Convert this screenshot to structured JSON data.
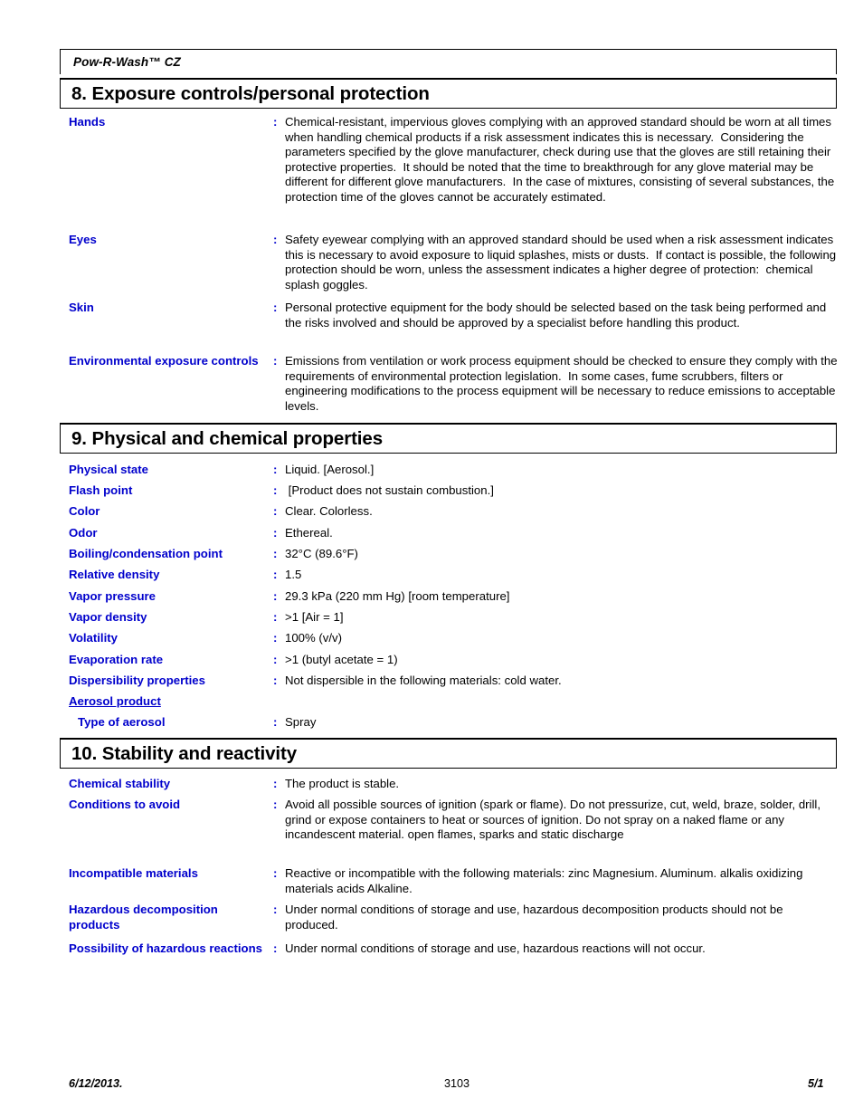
{
  "header": {
    "product_name": "Pow-R-Wash™ CZ"
  },
  "sections": [
    {
      "id": "section-8",
      "title": "8. Exposure controls/personal protection",
      "rows": [
        {
          "label": "Hands",
          "colon": ":",
          "value": "Chemical-resistant, impervious gloves complying with an approved standard should be worn at all times when handling chemical products if a risk assessment indicates this is necessary.  Considering the parameters specified by the glove manufacturer, check during use that the gloves are still retaining their protective properties.  It should be noted that the time to breakthrough for any glove material may be different for different glove manufacturers.  In the case of mixtures, consisting of several substances, the protection time of the gloves cannot be accurately estimated."
        },
        {
          "label": "Eyes",
          "colon": ":",
          "value": "Safety eyewear complying with an approved standard should be used when a risk assessment indicates this is necessary to avoid exposure to liquid splashes, mists or dusts.  If contact is possible, the following protection should be worn, unless the assessment indicates a higher degree of protection:  chemical splash goggles."
        },
        {
          "label": "Skin",
          "colon": ":",
          "value": "Personal protective equipment for the body should be selected based on the task being performed and the risks involved and should be approved by a specialist before handling this product."
        },
        {
          "label": "Environmental exposure controls",
          "colon": ":",
          "value": "Emissions from ventilation or work process equipment should be checked to ensure they comply with the requirements of environmental protection legislation.  In some cases, fume scrubbers, filters or engineering modifications to the process equipment will be necessary to reduce emissions to acceptable levels."
        }
      ]
    },
    {
      "id": "section-9",
      "title": "9. Physical and chemical properties",
      "rows": [
        {
          "label": "Physical state",
          "colon": ":",
          "value": "Liquid. [Aerosol.]"
        },
        {
          "label": "Flash point",
          "colon": ":",
          "value": " [Product does not sustain combustion.]"
        },
        {
          "label": "Color",
          "colon": ":",
          "value": "Clear. Colorless."
        },
        {
          "label": "Odor",
          "colon": ":",
          "value": "Ethereal."
        },
        {
          "label": "Boiling/condensation point",
          "colon": ":",
          "value": "32°C (89.6°F)"
        },
        {
          "label": "Relative density",
          "colon": ":",
          "value": "1.5"
        },
        {
          "label": "Vapor pressure",
          "colon": ":",
          "value": "29.3 kPa (220 mm Hg) [room temperature]"
        },
        {
          "label": "Vapor density",
          "colon": ":",
          "value": ">1 [Air = 1]"
        },
        {
          "label": "Volatility",
          "colon": ":",
          "value": "100% (v/v)"
        },
        {
          "label": "Evaporation rate",
          "colon": ":",
          "value": ">1 (butyl acetate = 1)"
        },
        {
          "label": "Dispersibility properties",
          "colon": ":",
          "value": "Not dispersible in the following materials: cold water."
        },
        {
          "label": "Aerosol product",
          "colon": "",
          "value": "",
          "style": "underline"
        },
        {
          "label": "Type of aerosol",
          "colon": ":",
          "value": "Spray",
          "style": "indent"
        }
      ]
    },
    {
      "id": "section-10",
      "title": "10. Stability and reactivity",
      "rows": [
        {
          "label": "Chemical stability",
          "colon": ":",
          "value": "The product is stable."
        },
        {
          "label": "Conditions to avoid",
          "colon": ":",
          "value": "Avoid all possible sources of ignition (spark or flame). Do not pressurize, cut, weld, braze, solder, drill, grind or expose containers to heat or sources of ignition. Do not spray on a naked flame or any incandescent material. open flames, sparks and static discharge"
        },
        {
          "label": "Incompatible materials",
          "colon": ":",
          "value": "Reactive or incompatible with the following materials: zinc Magnesium. Aluminum. alkalis oxidizing materials acids Alkaline."
        },
        {
          "label": "Hazardous decomposition products",
          "colon": ":",
          "value": "Under normal conditions of storage and use, hazardous decomposition products should not be produced."
        },
        {
          "label": "Possibility of hazardous reactions",
          "colon": ":",
          "value": "Under normal conditions of storage and use, hazardous reactions will not occur."
        }
      ]
    }
  ],
  "footer": {
    "date": "6/12/2013.",
    "code": "3103",
    "page": "5/1"
  },
  "colors": {
    "label_blue": "#0000CC",
    "text_black": "#000000",
    "rule": "#000000"
  }
}
